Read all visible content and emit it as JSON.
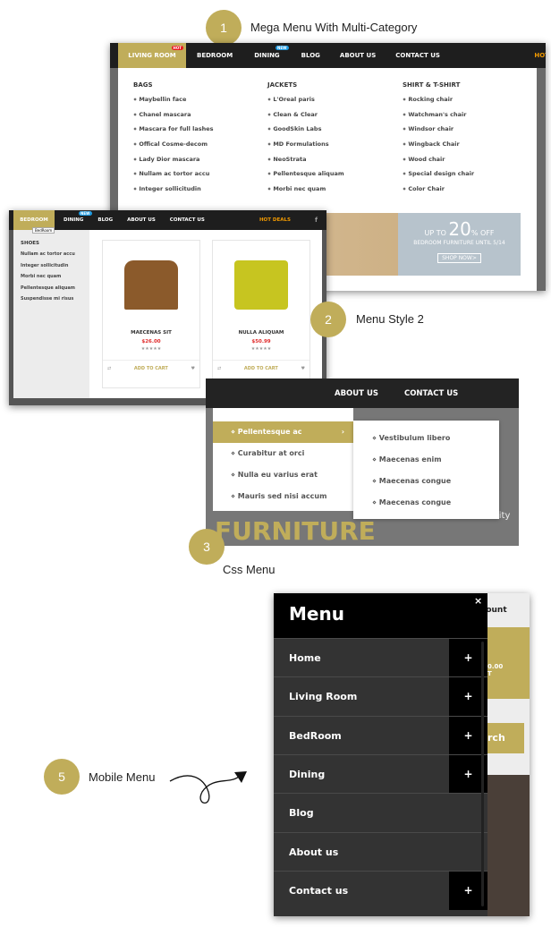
{
  "colors": {
    "accent": "#c0ad5a",
    "nav_bg": "#1e1e1e",
    "price": "#e02b2b",
    "hot": "#e8181e",
    "new": "#1e9be2",
    "hot_deals": "#f29a00"
  },
  "sections": [
    {
      "number": "1",
      "title": "Mega Menu With Multi-Category"
    },
    {
      "number": "2",
      "title": "Menu Style 2"
    },
    {
      "number": "3",
      "title": "Css Menu"
    },
    {
      "number": "5",
      "title": "Mobile Menu"
    }
  ],
  "mega": {
    "nav": [
      "LIVING ROOM",
      "BEDROOM",
      "DINING",
      "BLOG",
      "ABOUT US",
      "CONTACT US"
    ],
    "hot_badge": "HOT",
    "new_badge": "NEW",
    "hot_deals": "HOT",
    "columns": [
      {
        "title": "BAGS",
        "items": [
          "Maybellin face",
          "Chanel mascara",
          "Mascara for full lashes",
          "Offical Cosme-decom",
          "Lady Dior mascara",
          "Nullam ac tortor accu",
          "Integer sollicitudin"
        ]
      },
      {
        "title": "JACKETS",
        "items": [
          "L'Oreal paris",
          "Clean & Clear",
          "GoodSkin Labs",
          "MD Formulations",
          "NeoStrata",
          "Pellentesque aliquam",
          "Morbi nec quam"
        ]
      },
      {
        "title": "SHIRT & T-SHIRT",
        "items": [
          "Rocking chair",
          "Watchman's chair",
          "Windsor chair",
          "Wingback Chair",
          "Wood chair",
          "Special design chair",
          "Color Chair"
        ]
      }
    ],
    "banner": {
      "up_to": "UP TO",
      "percent": "20",
      "off": "% OFF",
      "subtitle": "BEDROOM FURNITURE UNTIL 5/14",
      "cta": "SHOP NOW>"
    }
  },
  "style2": {
    "nav": [
      "BEDROOM",
      "DINING",
      "BLOG",
      "ABOUT US",
      "CONTACT US"
    ],
    "new_badge": "NEW",
    "hot_deals": "HOT DEALS",
    "tooltip": "BedRoom",
    "sidebar": {
      "title": "SHOES",
      "items": [
        "Nullam ac tortor accu",
        "Integer sollicitudin",
        "Morbi nec quam",
        "Pellentesque aliquam",
        "Suspendisse mi risus"
      ]
    },
    "products": [
      {
        "name": "MAECENAS SIT",
        "price": "$26.00",
        "rating": 0,
        "cta": "ADD TO CART"
      },
      {
        "name": "NULLA ALIQUAM",
        "price": "$50.99",
        "rating": 0,
        "cta": "ADD TO CART"
      }
    ]
  },
  "css_menu": {
    "nav": [
      "ABOUT US",
      "CONTACT US"
    ],
    "items": [
      "Pellentesque ac",
      "Curabitur at orci",
      "Nulla eu varius erat",
      "Mauris sed nisi accum"
    ],
    "submenu": [
      "Vestibulum libero",
      "Maecenas enim",
      "Maecenas congue",
      "Maecenas congue"
    ],
    "bg_text": "FURNITURE",
    "bg_text2": "lity"
  },
  "mobile": {
    "title": "Menu",
    "close": "×",
    "items": [
      {
        "label": "Home",
        "plus": true
      },
      {
        "label": "Living Room",
        "plus": true
      },
      {
        "label": "BedRoom",
        "plus": true
      },
      {
        "label": "Dining",
        "plus": true
      },
      {
        "label": "Blog",
        "plus": false
      },
      {
        "label": "About us",
        "plus": false
      },
      {
        "label": "Contact us",
        "plus": true
      }
    ],
    "bg": {
      "account": "count",
      "price": "0.00",
      "t": "T",
      "search": "rch"
    }
  }
}
